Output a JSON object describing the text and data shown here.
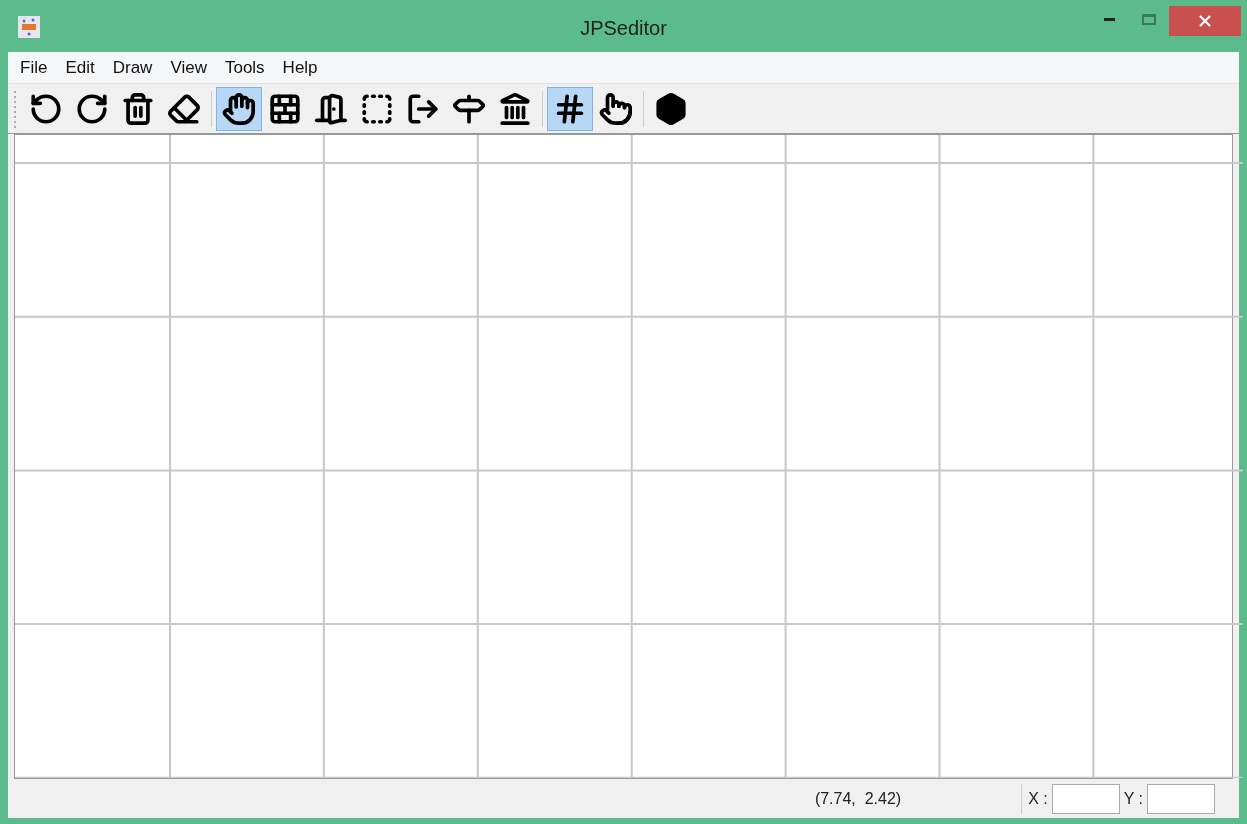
{
  "window": {
    "title": "JPSeditor"
  },
  "menu": [
    "File",
    "Edit",
    "Draw",
    "View",
    "Tools",
    "Help"
  ],
  "toolbar_groups": [
    [
      {
        "kind": "undo",
        "selected": false
      },
      {
        "kind": "redo",
        "selected": false
      },
      {
        "kind": "trash",
        "selected": false
      },
      {
        "kind": "eraser",
        "selected": false
      }
    ],
    [
      {
        "kind": "hand",
        "selected": true
      },
      {
        "kind": "wall",
        "selected": false
      },
      {
        "kind": "door",
        "selected": false
      },
      {
        "kind": "rect",
        "selected": false
      },
      {
        "kind": "exit",
        "selected": false
      },
      {
        "kind": "sign",
        "selected": false
      },
      {
        "kind": "landmark",
        "selected": false
      }
    ],
    [
      {
        "kind": "grid",
        "selected": true
      },
      {
        "kind": "touch",
        "selected": false
      }
    ],
    [
      {
        "kind": "box",
        "selected": false
      }
    ]
  ],
  "status_bar": {
    "coordinates": "(7.74,  2.42)",
    "x_label": "X :",
    "y_label": "Y :"
  }
}
